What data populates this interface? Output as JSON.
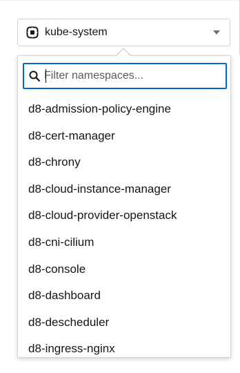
{
  "namespace_selector": {
    "current": "kube-system",
    "icon": "namespace-icon"
  },
  "filter": {
    "placeholder": "Filter namespaces...",
    "value": ""
  },
  "namespaces": [
    "d8-admission-policy-engine",
    "d8-cert-manager",
    "d8-chrony",
    "d8-cloud-instance-manager",
    "d8-cloud-provider-openstack",
    "d8-cni-cilium",
    "d8-console",
    "d8-dashboard",
    "d8-descheduler",
    "d8-ingress-nginx"
  ],
  "colors": {
    "accent": "#0066cc",
    "border": "#d2d2d2",
    "text": "#151515"
  }
}
